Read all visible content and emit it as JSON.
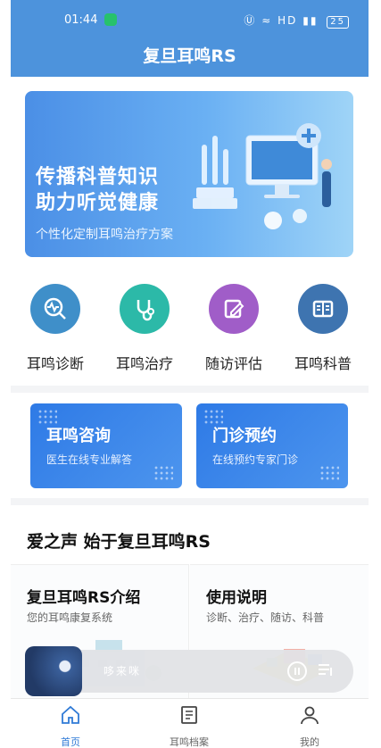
{
  "status_bar": {
    "time": "01:44",
    "battery": "25",
    "signal_text": "HD"
  },
  "header": {
    "title": "复旦耳鸣RS"
  },
  "banner": {
    "line1": "传播科普知识",
    "line2": "助力听觉健康",
    "subtitle": "个性化定制耳鸣治疗方案"
  },
  "features": [
    {
      "label": "耳鸣诊断",
      "icon": "diagnosis-icon",
      "color": "#3f8fc9"
    },
    {
      "label": "耳鸣治疗",
      "icon": "stethoscope-icon",
      "color": "#2cb9a8"
    },
    {
      "label": "随访评估",
      "icon": "edit-icon",
      "color": "#a05dc8"
    },
    {
      "label": "耳鸣科普",
      "icon": "book-icon",
      "color": "#3e74b0"
    }
  ],
  "cards": [
    {
      "title": "耳鸣咨询",
      "desc": "医生在线专业解答"
    },
    {
      "title": "门诊预约",
      "desc": "在线预约专家门诊"
    }
  ],
  "intro": {
    "heading": "爱之声 始于复旦耳鸣RS",
    "cards": [
      {
        "title": "复旦耳鸣RS介绍",
        "subtitle": "您的耳鸣康复系统"
      },
      {
        "title": "使用说明",
        "subtitle": "诊断、治疗、随访、科普"
      }
    ]
  },
  "player": {
    "track": "哆来咪"
  },
  "tabbar": [
    {
      "label": "首页",
      "icon": "home-icon",
      "active": true
    },
    {
      "label": "耳鸣档案",
      "icon": "document-icon",
      "active": false
    },
    {
      "label": "我的",
      "icon": "user-icon",
      "active": false
    }
  ],
  "colors": {
    "brand": "#4d93dc",
    "card_blue": "#2e7ae6",
    "tab_active": "#2f7ad6"
  }
}
